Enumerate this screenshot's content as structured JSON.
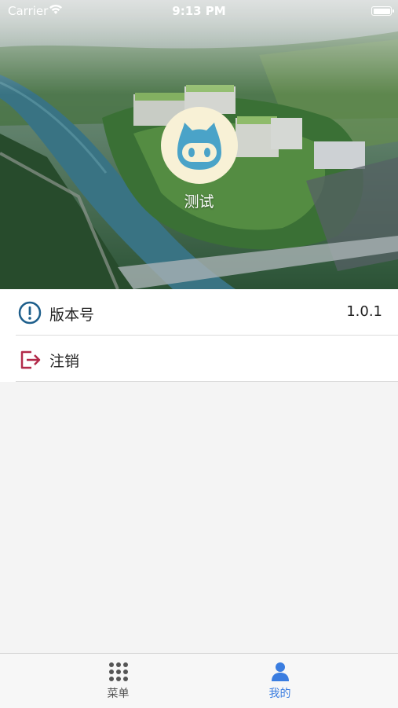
{
  "status_bar": {
    "carrier": "Carrier",
    "time": "9:13 PM",
    "wifi_icon": "wifi-icon",
    "battery_icon": "battery-icon"
  },
  "profile": {
    "user_name": "测试",
    "avatar_icon": "cat-avatar-icon"
  },
  "settings": {
    "items": [
      {
        "label": "版本号",
        "value": "1.0.1",
        "icon": "info-circle-icon",
        "icon_color": "#1e5f8c"
      },
      {
        "label": "注销",
        "value": "",
        "icon": "logout-icon",
        "icon_color": "#b22a4a"
      }
    ]
  },
  "tab_bar": {
    "tabs": [
      {
        "label": "菜单",
        "icon": "grid-dots-icon",
        "active": false
      },
      {
        "label": "我的",
        "icon": "person-icon",
        "active": true
      }
    ],
    "active_color": "#3b7de0",
    "inactive_color": "#555555"
  }
}
